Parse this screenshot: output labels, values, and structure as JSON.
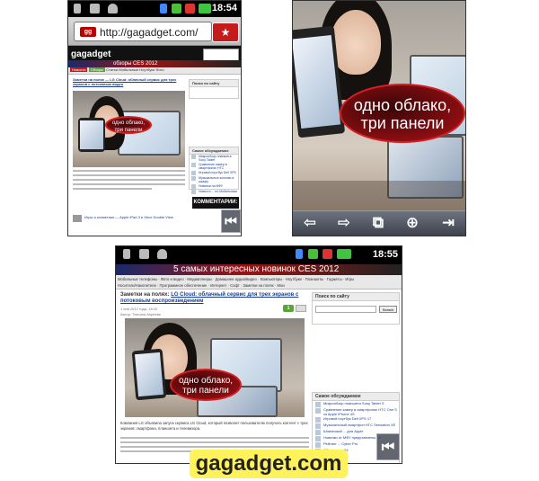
{
  "phone1": {
    "status": {
      "time": "18:54"
    },
    "browser": {
      "url": "http://gagadget.com/",
      "favicon_text": "gg"
    },
    "site": {
      "logo": "gagadget",
      "banner": "обзоры CES 2012",
      "menu": [
        "Новости",
        "Обзоры",
        "Статьи",
        "Мобильные",
        "Ноутбуки",
        "Фото"
      ],
      "article_title": "Заметки на полях — LG Cloud: облачный сервис для трех экранов с потоковым видео",
      "photo_caption_line1": "одно облако,",
      "photo_caption_line2": "три панели",
      "sidebar_title": "Поиск по сайту",
      "sidebar_title2": "Самое обсуждаемое",
      "sidebar_links": [
        "Микрообзор планшета Sony Tablet",
        "Сравнение камер в смартфонах HTC",
        "Игровой ноутбук Dell XPS",
        "Музыкальные колонки в шкафу",
        "Новинки на МФУ",
        "Новости ... по Мобильным"
      ],
      "ad_text": "КОММЕНТАРИИ:",
      "footer_item": "Игры и косметика — Apple iPad 3 и Xbox Double View"
    },
    "nav_button": "⏮"
  },
  "phone2": {
    "caption_line1": "одно облако,",
    "caption_line2": "три панели",
    "bottombar": [
      "⇦",
      "⇨",
      "⧉",
      "⊕",
      "⇥"
    ]
  },
  "phone3": {
    "status": {
      "time": "18:55"
    },
    "banner_text": "5 самых интересных новинок  CES 2012",
    "menu": [
      "Мобильные телефоны",
      "Фото и видео",
      "Медиаплееры",
      "Домашнее аудио/видео",
      "Компьютеры",
      "Ноутбуки",
      "Планшеты",
      "Гаджеты",
      "Игры"
    ],
    "submenu": [
      "Носители/Накопители",
      "Программное обеспечение",
      "Интернет",
      "Софт",
      "Заметки на полях",
      "Мои"
    ],
    "article_prefix": "Заметки на полях:",
    "article_title": "LG Cloud: облачный сервис для трех экранов с потоковым воспроизведением",
    "date": "1 янв 2012 года, 18:20",
    "author": "Автор: Татьяна Анрееве",
    "comments_badge": "1",
    "photo_caption_line1": "одно облако,",
    "photo_caption_line2": "три панели",
    "sidebar_search_title": "Поиск по сайту",
    "search_button": "Search",
    "sidebar_title2": "Самое обсуждаемое",
    "sidebar_links": [
      "Микрообзор планшета Sony Tablet S",
      "Сравнение камер в смартфонах HTC One S vs Apple iPhone 4S",
      "Игровой ноутбук Dell XPS 17",
      "Музыкальный смартфон HTC Sensation XE",
      "Шпионский ... для Apple",
      "Новинки от МФУ представлены на",
      "Рейтинг ... Cyber Pro",
      "Обзор на ... X4"
    ],
    "body_text": "Компания LG объявила запуск сервиса LG Cloud, который позволит пользователю получать контент с трех экранов: смартфона, планшета и телевизора.",
    "nav_button": "⏮"
  },
  "watermark": "gagadget.com"
}
